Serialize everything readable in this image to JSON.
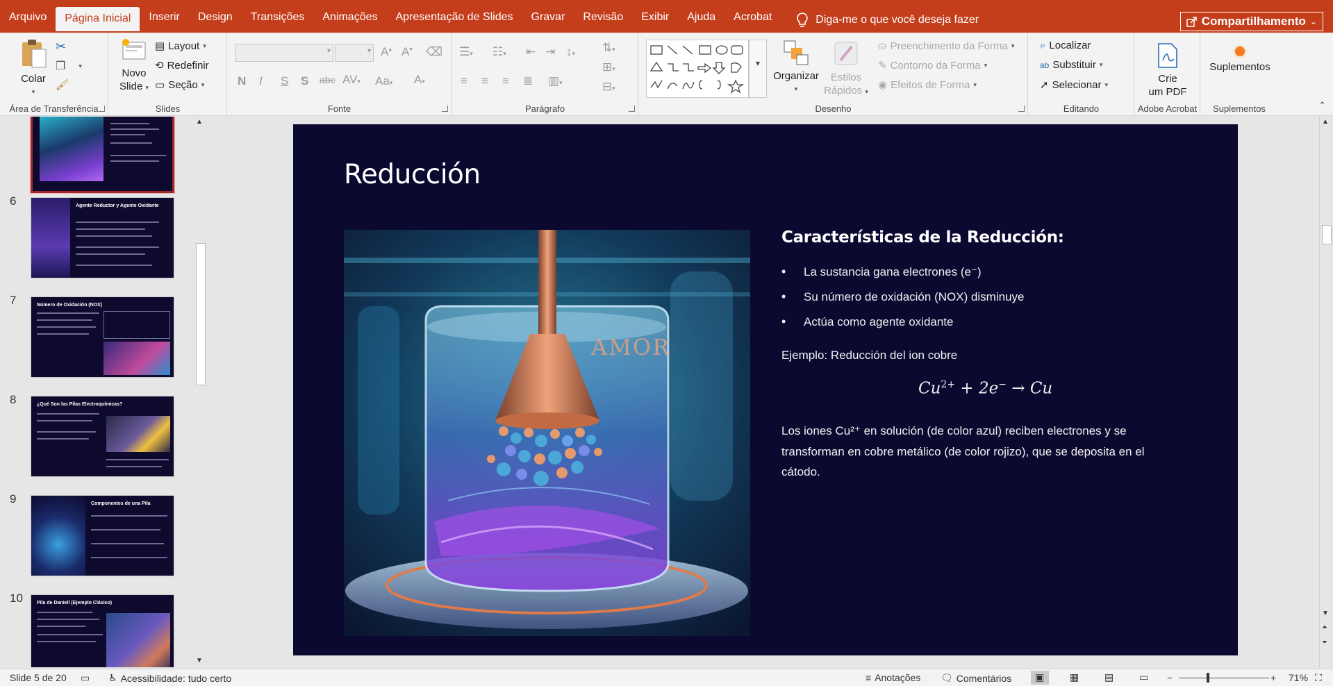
{
  "tabs": {
    "items": [
      "Arquivo",
      "Página Inicial",
      "Inserir",
      "Design",
      "Transições",
      "Animações",
      "Apresentação de Slides",
      "Gravar",
      "Revisão",
      "Exibir",
      "Ajuda",
      "Acrobat"
    ],
    "active": "Página Inicial",
    "tell_me": "Diga-me o que você deseja fazer",
    "share": "Compartilhamento"
  },
  "ribbon": {
    "clipboard": {
      "label": "Área de Transferência",
      "paste": "Colar"
    },
    "slides": {
      "label": "Slides",
      "new_slide_1": "Novo",
      "new_slide_2": "Slide",
      "layout": "Layout",
      "reset": "Redefinir",
      "section": "Seção"
    },
    "font": {
      "label": "Fonte"
    },
    "paragraph": {
      "label": "Parágrafo"
    },
    "drawing": {
      "label": "Desenho",
      "arrange": "Organizar",
      "quick_styles_1": "Estilos",
      "quick_styles_2": "Rápidos",
      "shape_fill": "Preenchimento da Forma",
      "shape_outline": "Contorno da Forma",
      "shape_effects": "Efeitos de Forma"
    },
    "editing": {
      "label": "Editando",
      "find": "Localizar",
      "replace": "Substituir",
      "select": "Selecionar"
    },
    "acrobat": {
      "label": "Adobe Acrobat",
      "create_pdf_1": "Crie",
      "create_pdf_2": "um PDF"
    },
    "addins": {
      "label": "Suplementos",
      "addins_btn": "Suplementos"
    }
  },
  "thumbnails": [
    {
      "number": "",
      "title": "",
      "selected": true
    },
    {
      "number": "6",
      "title": "Agente Reductor y Agente Oxidante"
    },
    {
      "number": "7",
      "title": "Número de Oxidación (NOX)"
    },
    {
      "number": "8",
      "title": "¿Qué Son las Pilas Electroquímicas?"
    },
    {
      "number": "9",
      "title": "Componentes de una Pila"
    },
    {
      "number": "10",
      "title": "Pila de Daniell (Ejemplo Clásico)"
    }
  ],
  "slide": {
    "title": "Reducción",
    "image_text": "AMOR",
    "subheading": "Características de la Reducción:",
    "bullets": [
      "La sustancia gana electrones (e⁻)",
      "Su número de oxidación (NOX) disminuye",
      "Actúa como agente oxidante"
    ],
    "example": "Ejemplo: Reducción del ion cobre",
    "equation": {
      "a": "Cu",
      "a_sup": "2+",
      "plus": " + 2e",
      "e_sup": "−",
      "arrow": " → Cu"
    },
    "description": "Los iones Cu²⁺ en solución (de color azul) reciben electrones y se transforman en cobre metálico (de color rojizo), que se deposita en el cátodo."
  },
  "status": {
    "slide_info": "Slide 5 de 20",
    "accessibility": "Acessibilidade: tudo certo",
    "notes": "Anotações",
    "comments": "Comentários",
    "zoom": "71%"
  },
  "colors": {
    "ribbon_accent": "#c43e1c",
    "slide_bg": "#0c0930"
  }
}
